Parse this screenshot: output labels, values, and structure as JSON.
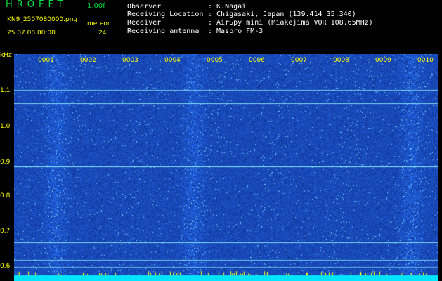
{
  "app": {
    "title": "HROFFT",
    "version": "1.00f"
  },
  "file": {
    "name": "KN9_2507080000.png",
    "datetime": "25.07.08 00:00",
    "meteor_label": "meteor",
    "meteor_count": "24"
  },
  "info": [
    {
      "label": "Observer",
      "value": ": K.Nagai"
    },
    {
      "label": "Receiving Location",
      "value": ": Chigasaki, Japan (139.414 35.340)"
    },
    {
      "label": "Receiver",
      "value": ": AirSpy mini (Miakejima VOR 108.65MHz)"
    },
    {
      "label": "Receiving antenna",
      "value": ": Maspro FM-3"
    }
  ],
  "spectrogram": {
    "y_unit": "kHz",
    "y_ticks": [
      "1.1",
      "1.0",
      "0.9",
      "0.8",
      "0.7",
      "0.6"
    ],
    "x_ticks": [
      "0001",
      "0002",
      "0003",
      "0004",
      "0005",
      "0006",
      "0007",
      "0008",
      "0009",
      "0010"
    ],
    "colors": {
      "background": "#0a1a8a",
      "noise": "#2a5cff",
      "signal": "#7fffff",
      "tick": "#ffff00"
    }
  }
}
